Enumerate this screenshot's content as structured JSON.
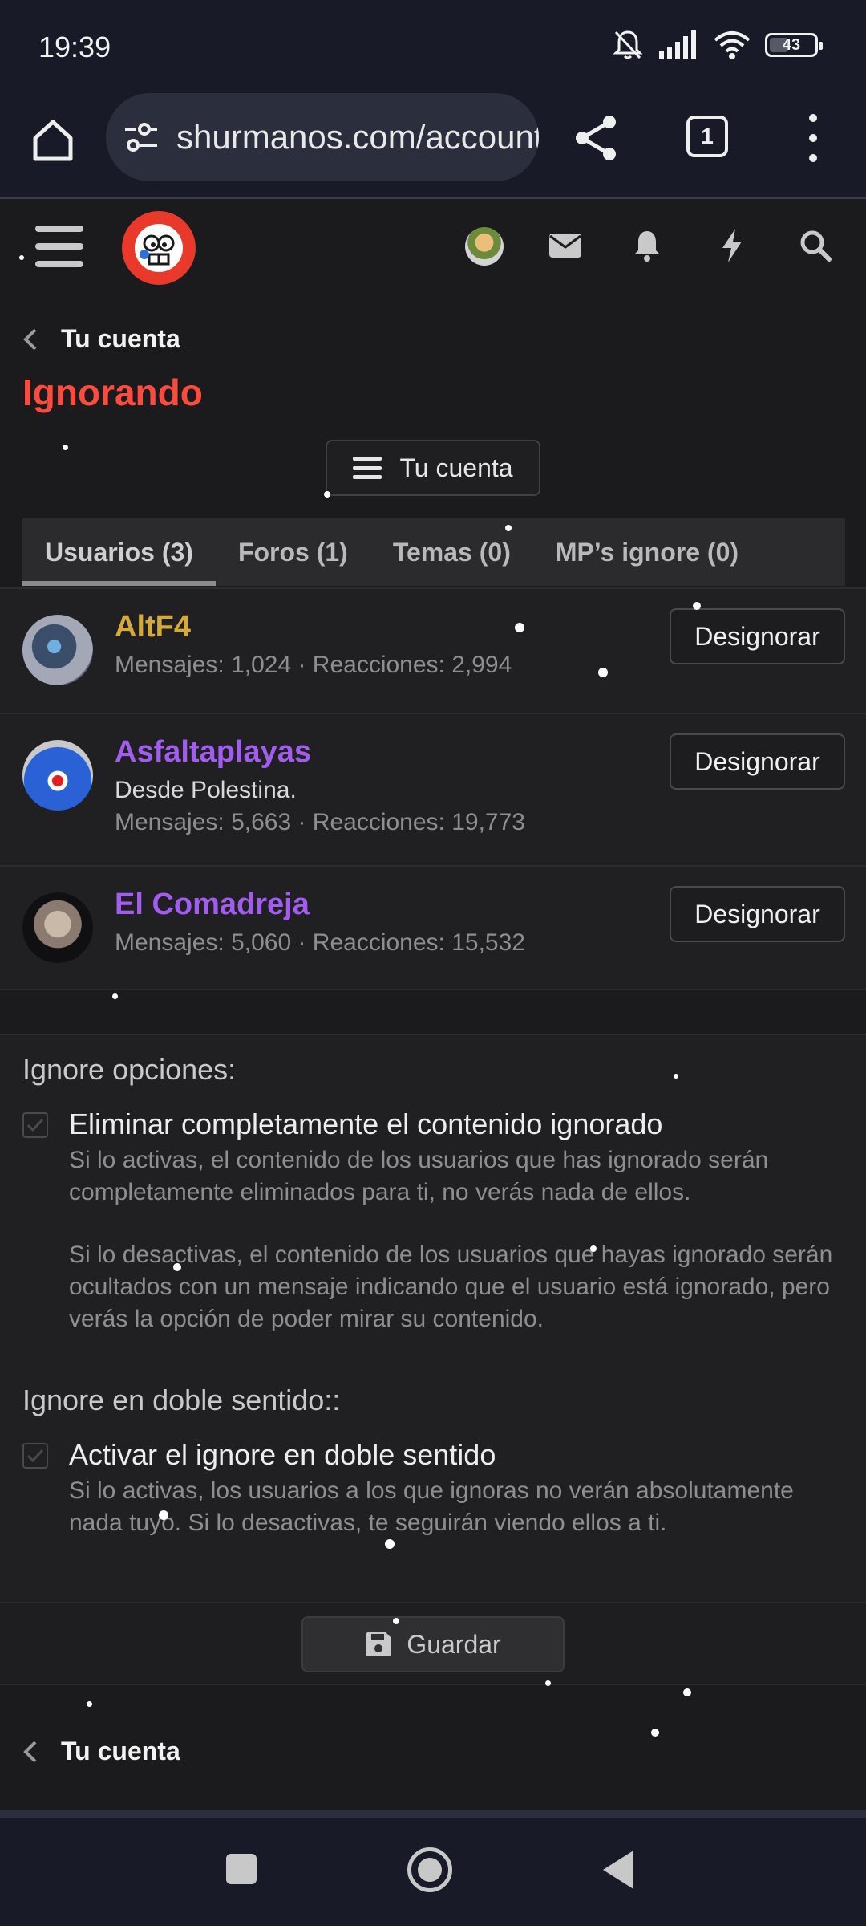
{
  "status": {
    "time": "19:39",
    "battery": "43",
    "battery_level": 0.43
  },
  "browser": {
    "url": "shurmanos.com/account/ignored",
    "tab_count": "1"
  },
  "breadcrumb": {
    "label": "Tu cuenta"
  },
  "page": {
    "title": "Ignorando",
    "account_menu_label": "Tu cuenta"
  },
  "tabs": [
    {
      "label": "Usuarios (3)",
      "active": true
    },
    {
      "label": "Foros (1)"
    },
    {
      "label": "Temas (0)"
    },
    {
      "label": "MP’s ignore (0)"
    }
  ],
  "users": [
    {
      "name": "AltF4",
      "name_color": "#d6a93a",
      "tagline": "",
      "stats": "Mensajes: 1,024 · Reacciones: 2,994",
      "button": "Designorar"
    },
    {
      "name": "Asfaltaplayas",
      "name_color": "#a35cf0",
      "tagline": "Desde Polestina.",
      "stats": "Mensajes: 5,663 · Reacciones: 19,773",
      "button": "Designorar"
    },
    {
      "name": "El Comadreja",
      "name_color": "#a35cf0",
      "tagline": "",
      "stats": "Mensajes: 5,060 · Reacciones: 15,532",
      "button": "Designorar"
    }
  ],
  "options": {
    "ignore_heading": "Ignore opciones:",
    "remove_label": "Eliminar completamente el contenido ignorado",
    "remove_desc_1": "Si lo activas, el contenido de los usuarios que has ignorado serán completamente eliminados para ti, no verás nada de ellos.",
    "remove_desc_2": "Si lo desactivas, el contenido de los usuarios que hayas ignorado serán ocultados con un mensaje indicando que el usuario está ignorado, pero verás la opción de poder mirar su contenido.",
    "double_heading": "Ignore en doble sentido::",
    "double_label": "Activar el ignore en doble sentido",
    "double_desc": "Si lo activas, los usuarios a los que ignoras no verán absolutamente nada tuyo. Si lo desactivas, te seguirán viendo ellos a ti."
  },
  "save": {
    "label": "Guardar"
  },
  "footer_breadcrumb": {
    "label": "Tu cuenta"
  },
  "colors": {
    "title": "#ff4b3e",
    "logo": "#e8392a",
    "background": "#1b1b1d"
  }
}
